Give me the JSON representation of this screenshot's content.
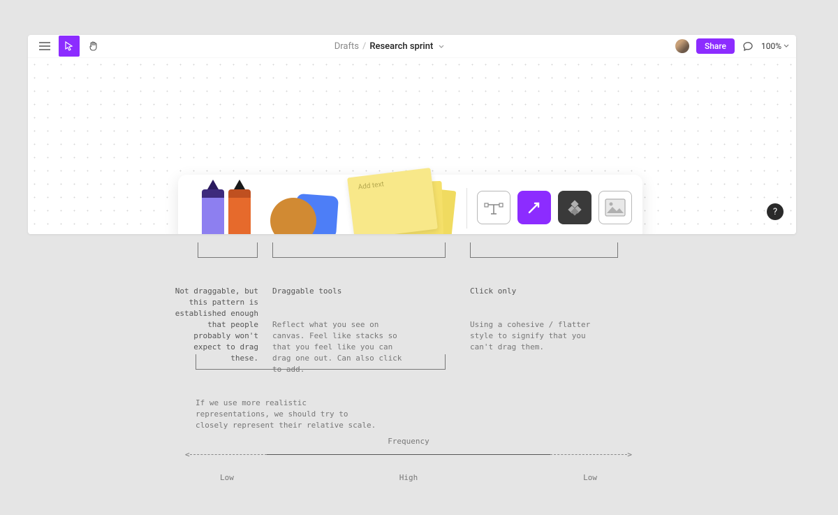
{
  "breadcrumb": {
    "folder": "Drafts",
    "title": "Research sprint"
  },
  "topbar": {
    "share_label": "Share",
    "zoom": "100%"
  },
  "note_placeholder": "Add text",
  "help_label": "?",
  "annotations": {
    "markers": {
      "heading": "Not draggable, but this pattern is established enough that people probably won't expect to drag these."
    },
    "drag": {
      "heading": "Draggable tools",
      "body": "Reflect what you see on canvas. Feel like stacks so that you feel like you can drag one out. Can also click to add."
    },
    "click": {
      "heading": "Click only",
      "body": "Using a cohesive / flatter style to signify that you can't drag them."
    },
    "scale": {
      "body": "If we use more realistic representations, we should try to closely represent their relative scale."
    }
  },
  "frequency": {
    "title": "Frequency",
    "low": "Low",
    "high": "High"
  }
}
